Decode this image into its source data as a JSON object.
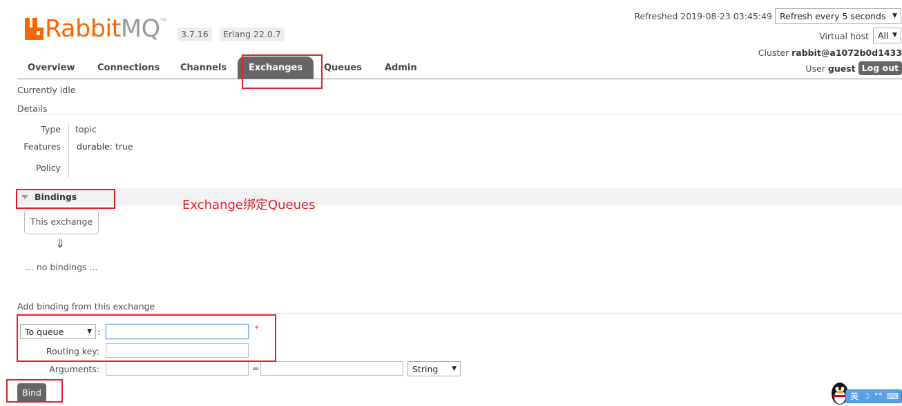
{
  "header": {
    "logo": {
      "brand_prefix": "Rabbit",
      "brand_suffix": "MQ",
      "tm": "TM"
    },
    "version": "3.7.16",
    "erlang": "Erlang 22.0.7",
    "refreshed": "Refreshed 2019-08-23 03:45:49",
    "refresh_select": "Refresh every 5 seconds",
    "virtual_host_label": "Virtual host",
    "virtual_host_value": "All",
    "cluster_label": "Cluster",
    "cluster_value": "rabbit@a1072b0d1433",
    "user_label": "User",
    "user_value": "guest",
    "logout_label": "Log out"
  },
  "nav": {
    "tabs": [
      "Overview",
      "Connections",
      "Channels",
      "Exchanges",
      "Queues",
      "Admin"
    ],
    "active": "Exchanges"
  },
  "status": "Currently idle",
  "details": {
    "title": "Details",
    "type_label": "Type",
    "type_value": "topic",
    "features_label": "Features",
    "features_key": "durable:",
    "features_value": "true",
    "policy_label": "Policy"
  },
  "bindings": {
    "title": "Bindings",
    "this_exchange": "This exchange",
    "arrow": "⇓",
    "empty": "... no bindings ..."
  },
  "add_binding": {
    "title": "Add binding from this exchange",
    "destination_type": "To queue",
    "colon": ":",
    "required_mark": "*",
    "routing_key_label": "Routing key:",
    "arguments_label": "Arguments:",
    "equals": "=",
    "arg_type": "String",
    "bind_label": "Bind"
  },
  "annotation": "Exchange绑定Queues",
  "ime": {
    "lang": "英",
    "moon": "☽",
    "dots": "°°",
    "kbd": "⌨"
  },
  "colors": {
    "accent": "#ff6600",
    "tab_active": "#666666",
    "annotation_red": "#e3202a"
  }
}
